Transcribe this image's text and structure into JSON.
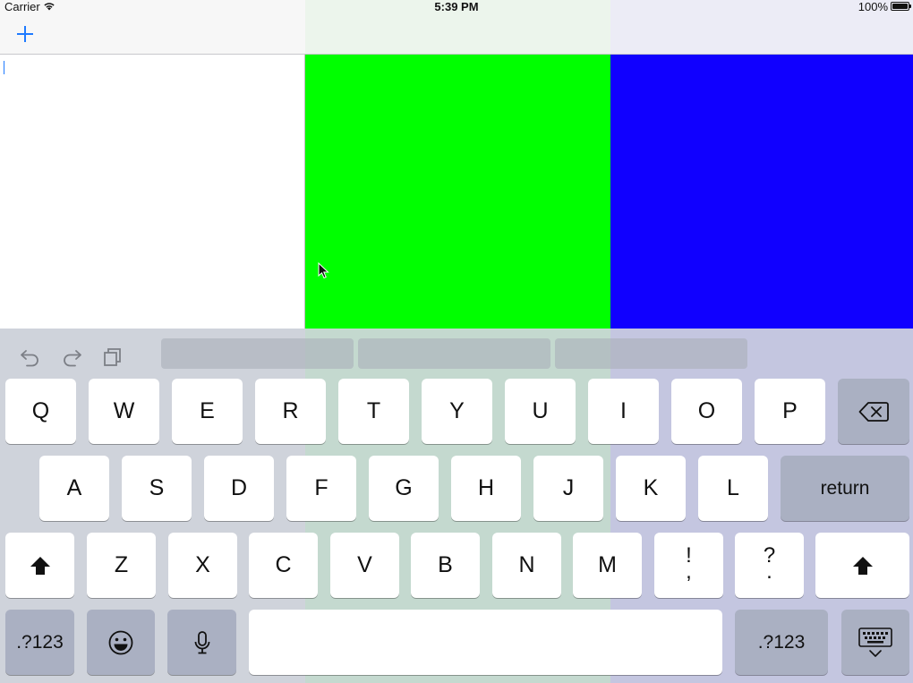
{
  "status_bar": {
    "carrier": "Carrier",
    "time": "5:39 PM",
    "battery_percent": "100%",
    "battery_level": 1.0
  },
  "nav_bar": {
    "add_icon": "plus-icon",
    "accent_color": "#1f7bff"
  },
  "panels": {
    "colors": [
      "#ffffff",
      "#00ff00",
      "#1000ff"
    ]
  },
  "keyboard": {
    "shortcuts": [
      "undo-icon",
      "redo-icon",
      "paste-icon"
    ],
    "suggestions": [
      "",
      "",
      ""
    ],
    "row1": [
      "Q",
      "W",
      "E",
      "R",
      "T",
      "Y",
      "U",
      "I",
      "O",
      "P"
    ],
    "row2": [
      "A",
      "S",
      "D",
      "F",
      "G",
      "H",
      "J",
      "K",
      "L"
    ],
    "row3": [
      "Z",
      "X",
      "C",
      "V",
      "B",
      "N",
      "M"
    ],
    "punct_1": {
      "top": "!",
      "bottom": ","
    },
    "punct_2": {
      "top": "?",
      "bottom": "."
    },
    "return_label": "return",
    "numbers_left_label": ".?123",
    "numbers_right_label": ".?123",
    "space_label": "",
    "icons": {
      "delete": "backspace-icon",
      "shift": "shift-icon",
      "emoji": "emoji-icon",
      "mic": "microphone-icon",
      "dismiss": "keyboard-dismiss-icon"
    }
  }
}
